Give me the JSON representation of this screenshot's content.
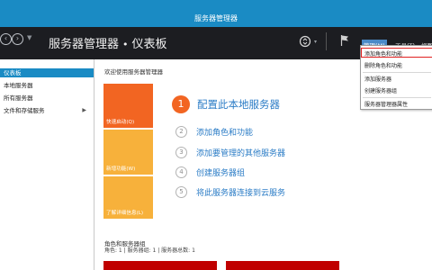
{
  "window": {
    "title": "服务器管理器"
  },
  "toolbar": {
    "breadcrumb_app": "服务器管理器",
    "breadcrumb_separator": "•",
    "breadcrumb_page": "仪表板",
    "menus": [
      "管理(M)",
      "工具(T)",
      "视图"
    ],
    "active_menu": "管理(M)"
  },
  "sidebar": {
    "items": [
      {
        "label": "仪表板",
        "selected": true
      },
      {
        "label": "本地服务器",
        "selected": false
      },
      {
        "label": "所有服务器",
        "selected": false
      },
      {
        "label": "文件和存储服务",
        "selected": false,
        "has_submenu": true
      }
    ]
  },
  "main": {
    "welcome": "欢迎使用服务器管理器",
    "tiles": [
      {
        "label": "快速启动(Q)",
        "color": "#f26522"
      },
      {
        "label": "新增功能(W)",
        "color": "#f7b13b"
      },
      {
        "label": "了解详细信息(L)",
        "color": "#f7b13b"
      }
    ],
    "steps": [
      {
        "num": "1",
        "label": "配置此本地服务器"
      },
      {
        "num": "2",
        "label": "添加角色和功能"
      },
      {
        "num": "3",
        "label": "添加要管理的其他服务器"
      },
      {
        "num": "4",
        "label": "创建服务器组"
      },
      {
        "num": "5",
        "label": "将此服务器连接到云服务"
      }
    ],
    "roles_title": "角色和服务器组",
    "roles_summary": "角色: 1 | 服务器组: 1 | 服务器总数: 1"
  },
  "manage_menu": {
    "items": [
      "添加角色和功能",
      "删除角色和功能",
      "添加服务器",
      "创建服务器组",
      "服务器管理器属性"
    ],
    "highlighted": "添加角色和功能"
  },
  "colors": {
    "titlebar": "#1a8bc4",
    "toolbar": "#1c1d21",
    "accent_orange": "#f26522",
    "tile_yellow": "#f7b13b",
    "link_blue": "#2b7cc6",
    "highlight_red": "#e02020",
    "status_red": "#c00000"
  }
}
